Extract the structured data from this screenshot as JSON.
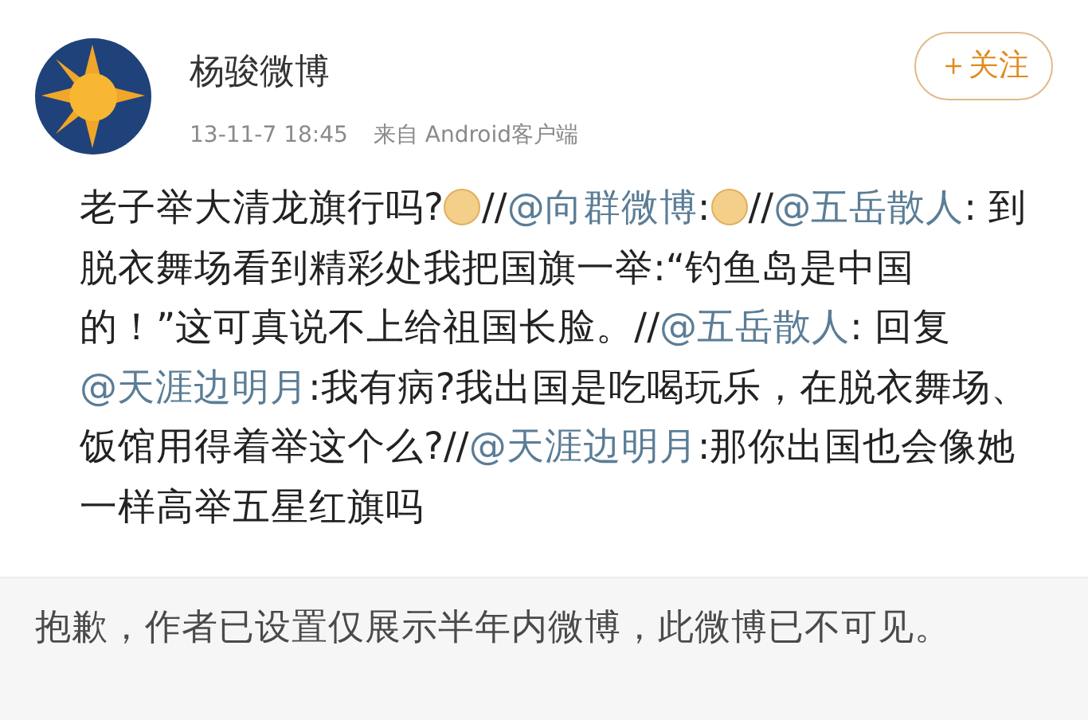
{
  "user": {
    "name": "杨骏微博",
    "time": "13-11-7 18:45",
    "source": "来自 Android客户端"
  },
  "follow_button": {
    "label": "＋关注"
  },
  "post": {
    "segments": [
      {
        "kind": "text",
        "text": "老子举大清龙旗行吗?"
      },
      {
        "kind": "emoji"
      },
      {
        "kind": "text",
        "text": "//"
      },
      {
        "kind": "mention",
        "text": "@向群微博"
      },
      {
        "kind": "text",
        "text": ":"
      },
      {
        "kind": "emoji"
      },
      {
        "kind": "text",
        "text": "//"
      },
      {
        "kind": "mention",
        "text": "@五岳散人"
      },
      {
        "kind": "text",
        "text": ": 到脱衣舞场看到精彩处我把国旗一举:“钓鱼岛是中国的！”这可真说不上给祖国长脸。//"
      },
      {
        "kind": "mention",
        "text": "@五岳散人"
      },
      {
        "kind": "text",
        "text": ": 回复"
      },
      {
        "kind": "mention",
        "text": "@天涯边明月"
      },
      {
        "kind": "text",
        "text": ":我有病?我出国是吃喝玩乐，在脱衣舞场、饭馆用得着举这个么?//"
      },
      {
        "kind": "mention",
        "text": "@天涯边明月"
      },
      {
        "kind": "text",
        "text": ":那你出国也会像她一样高举五星红旗吗"
      }
    ]
  },
  "notice": "抱歉，作者已设置仅展示半年内微博，此微博已不可见。"
}
